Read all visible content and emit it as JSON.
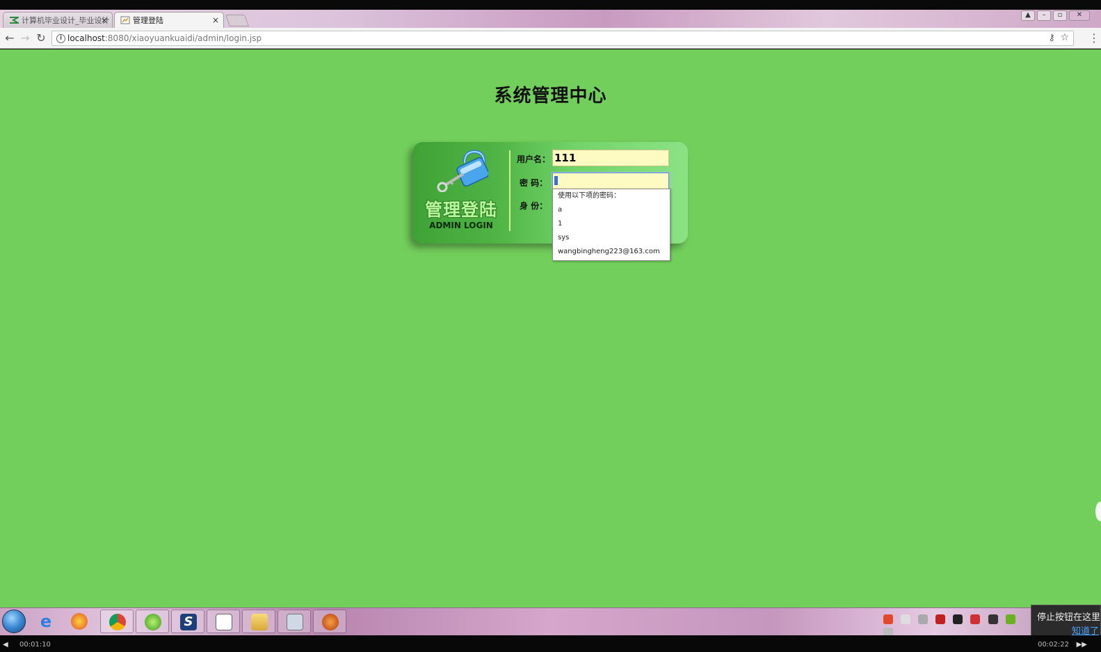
{
  "tabs": [
    {
      "label": "计算机毕业设计_毕业设计",
      "close": "×",
      "active": false
    },
    {
      "label": "管理登陆",
      "close": "×",
      "active": true
    }
  ],
  "address": {
    "host": "localhost",
    "path": ":8080/xiaoyuankuaidi/admin/login.jsp"
  },
  "page": {
    "title": "系统管理中心",
    "login_cn": "管理登陆",
    "login_en": "ADMIN LOGIN",
    "username_label": "用户名：",
    "username_value": "111",
    "password_label": "密  码：",
    "role_label": "身  份：",
    "autocomplete": {
      "header": "使用以下项的密码：",
      "options": [
        "a",
        "1",
        "sys",
        "wangbingheng223@163.com"
      ]
    }
  },
  "overlay": {
    "notice_line1": "停止按钮在这里",
    "notice_link": "知道了",
    "time_elapsed": "00:01:10",
    "time_total": "00:02:22"
  },
  "colors": {
    "page_bg": "#73cf5c",
    "input_bg": "#fdfbc1"
  }
}
